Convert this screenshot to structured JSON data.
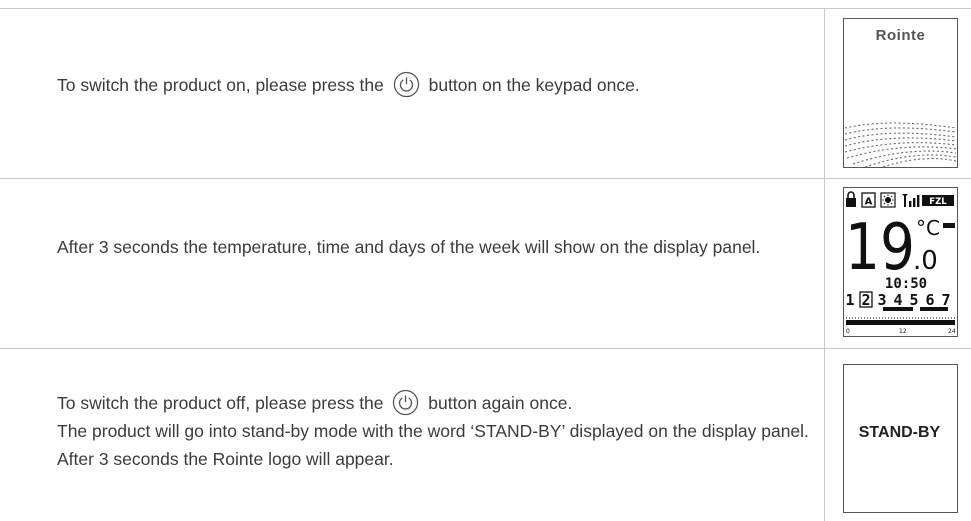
{
  "rows": [
    {
      "text_before": "To switch the product on, please press the",
      "text_after": "button on the keypad once.",
      "display": {
        "logo": "Rointe"
      }
    },
    {
      "text": "After 3 seconds the temperature, time and days of the week will show on the display panel.",
      "display": {
        "temp_int": "19",
        "temp_unit": "°C",
        "temp_dec": ".0",
        "time": "10:50",
        "days": [
          "1",
          "2",
          "3",
          "4",
          "5",
          "6",
          "7"
        ],
        "selected_day": "2",
        "axis": [
          "0",
          "12",
          "24"
        ],
        "status_label": "FZL"
      }
    },
    {
      "line1_before": "To switch the product off, please press the",
      "line1_after": "button again once.",
      "line2": "The product will go into stand-by mode with the word ‘STAND-BY’ displayed on the display panel. After 3 seconds the Rointe logo will appear.",
      "display": {
        "label": "STAND-BY"
      }
    }
  ],
  "icons": [
    "power-icon",
    "lock-icon",
    "auto-mode-icon",
    "sun-icon",
    "signal-icon"
  ]
}
